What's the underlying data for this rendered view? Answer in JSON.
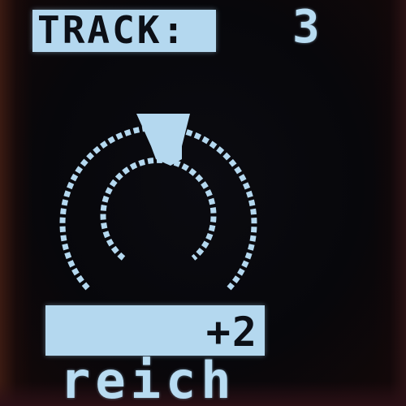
{
  "header": {
    "label": "TRACK:",
    "track_number": "3"
  },
  "knob": {
    "icon": "rotary-knob-icon",
    "level": 0.5
  },
  "parameter": {
    "value": "+2",
    "name": "reich"
  },
  "colors": {
    "display_foreground": "#b4d8ef",
    "display_background": "#07070b"
  }
}
